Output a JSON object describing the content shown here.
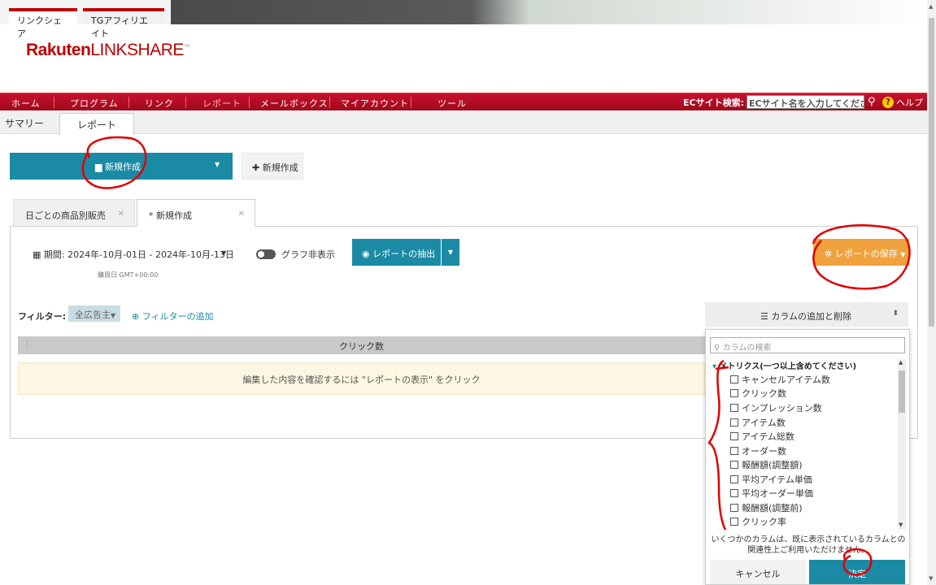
{
  "brand_tabs": [
    "リンクシェア",
    "TGアフィリエイト"
  ],
  "logo": {
    "bold": "Rakuten",
    "light": "LINKSHARE",
    "tm": "™"
  },
  "nav": {
    "items": [
      "ホーム",
      "プログラム",
      "リンク",
      "レポート",
      "メールボックス",
      "マイアカウント",
      "ツール"
    ],
    "active": "レポート",
    "ec_label": "ECサイト検索:",
    "ec_placeholder": "ECサイト名を入力してください。",
    "help": "ヘルプ"
  },
  "subtabs": {
    "summary": "サマリー",
    "report": "レポート"
  },
  "toolbar": {
    "new_main": "新規作成",
    "new_alt": "新規作成"
  },
  "report_tabs": [
    {
      "label": "日ごとの商品別販売"
    },
    {
      "label": "* 新規作成"
    }
  ],
  "controls": {
    "period": "期間: 2024年-10月-01日 - 2024年-10月-13日",
    "period_sub": "購買日 GMT+00:00",
    "graph_toggle": "グラフ非表示",
    "extract": "レポートの抽出",
    "save": "レポートの保存"
  },
  "filter": {
    "label": "フィルター:",
    "chip": "全広告主",
    "add": "フィルターの追加"
  },
  "columns_button": "カラムの追加と削除",
  "table": {
    "header": "クリック数",
    "notice": "編集した内容を確認するには \"レポートの表示\" をクリック"
  },
  "dropdown": {
    "search_placeholder": "カラムの検索",
    "group": "メトリクス(一つ以上含めてください)",
    "items": [
      "キャンセルアイテム数",
      "クリック数",
      "インプレッション数",
      "アイテム数",
      "アイテム総数",
      "オーダー数",
      "報酬額(調整額)",
      "平均アイテム単価",
      "平均オーダー単価",
      "報酬額(調整前)",
      "クリック率"
    ],
    "note_line1": "いくつかのカラムは、既に表示されているカラムとの",
    "note_line2": "関連性上ご利用いただけません。",
    "cancel": "キャンセル",
    "ok": "決定"
  },
  "colors": {
    "brand_red": "#bf0000",
    "teal": "#1b8aa5",
    "orange": "#f0a23f",
    "annotation_red": "#e00000"
  }
}
